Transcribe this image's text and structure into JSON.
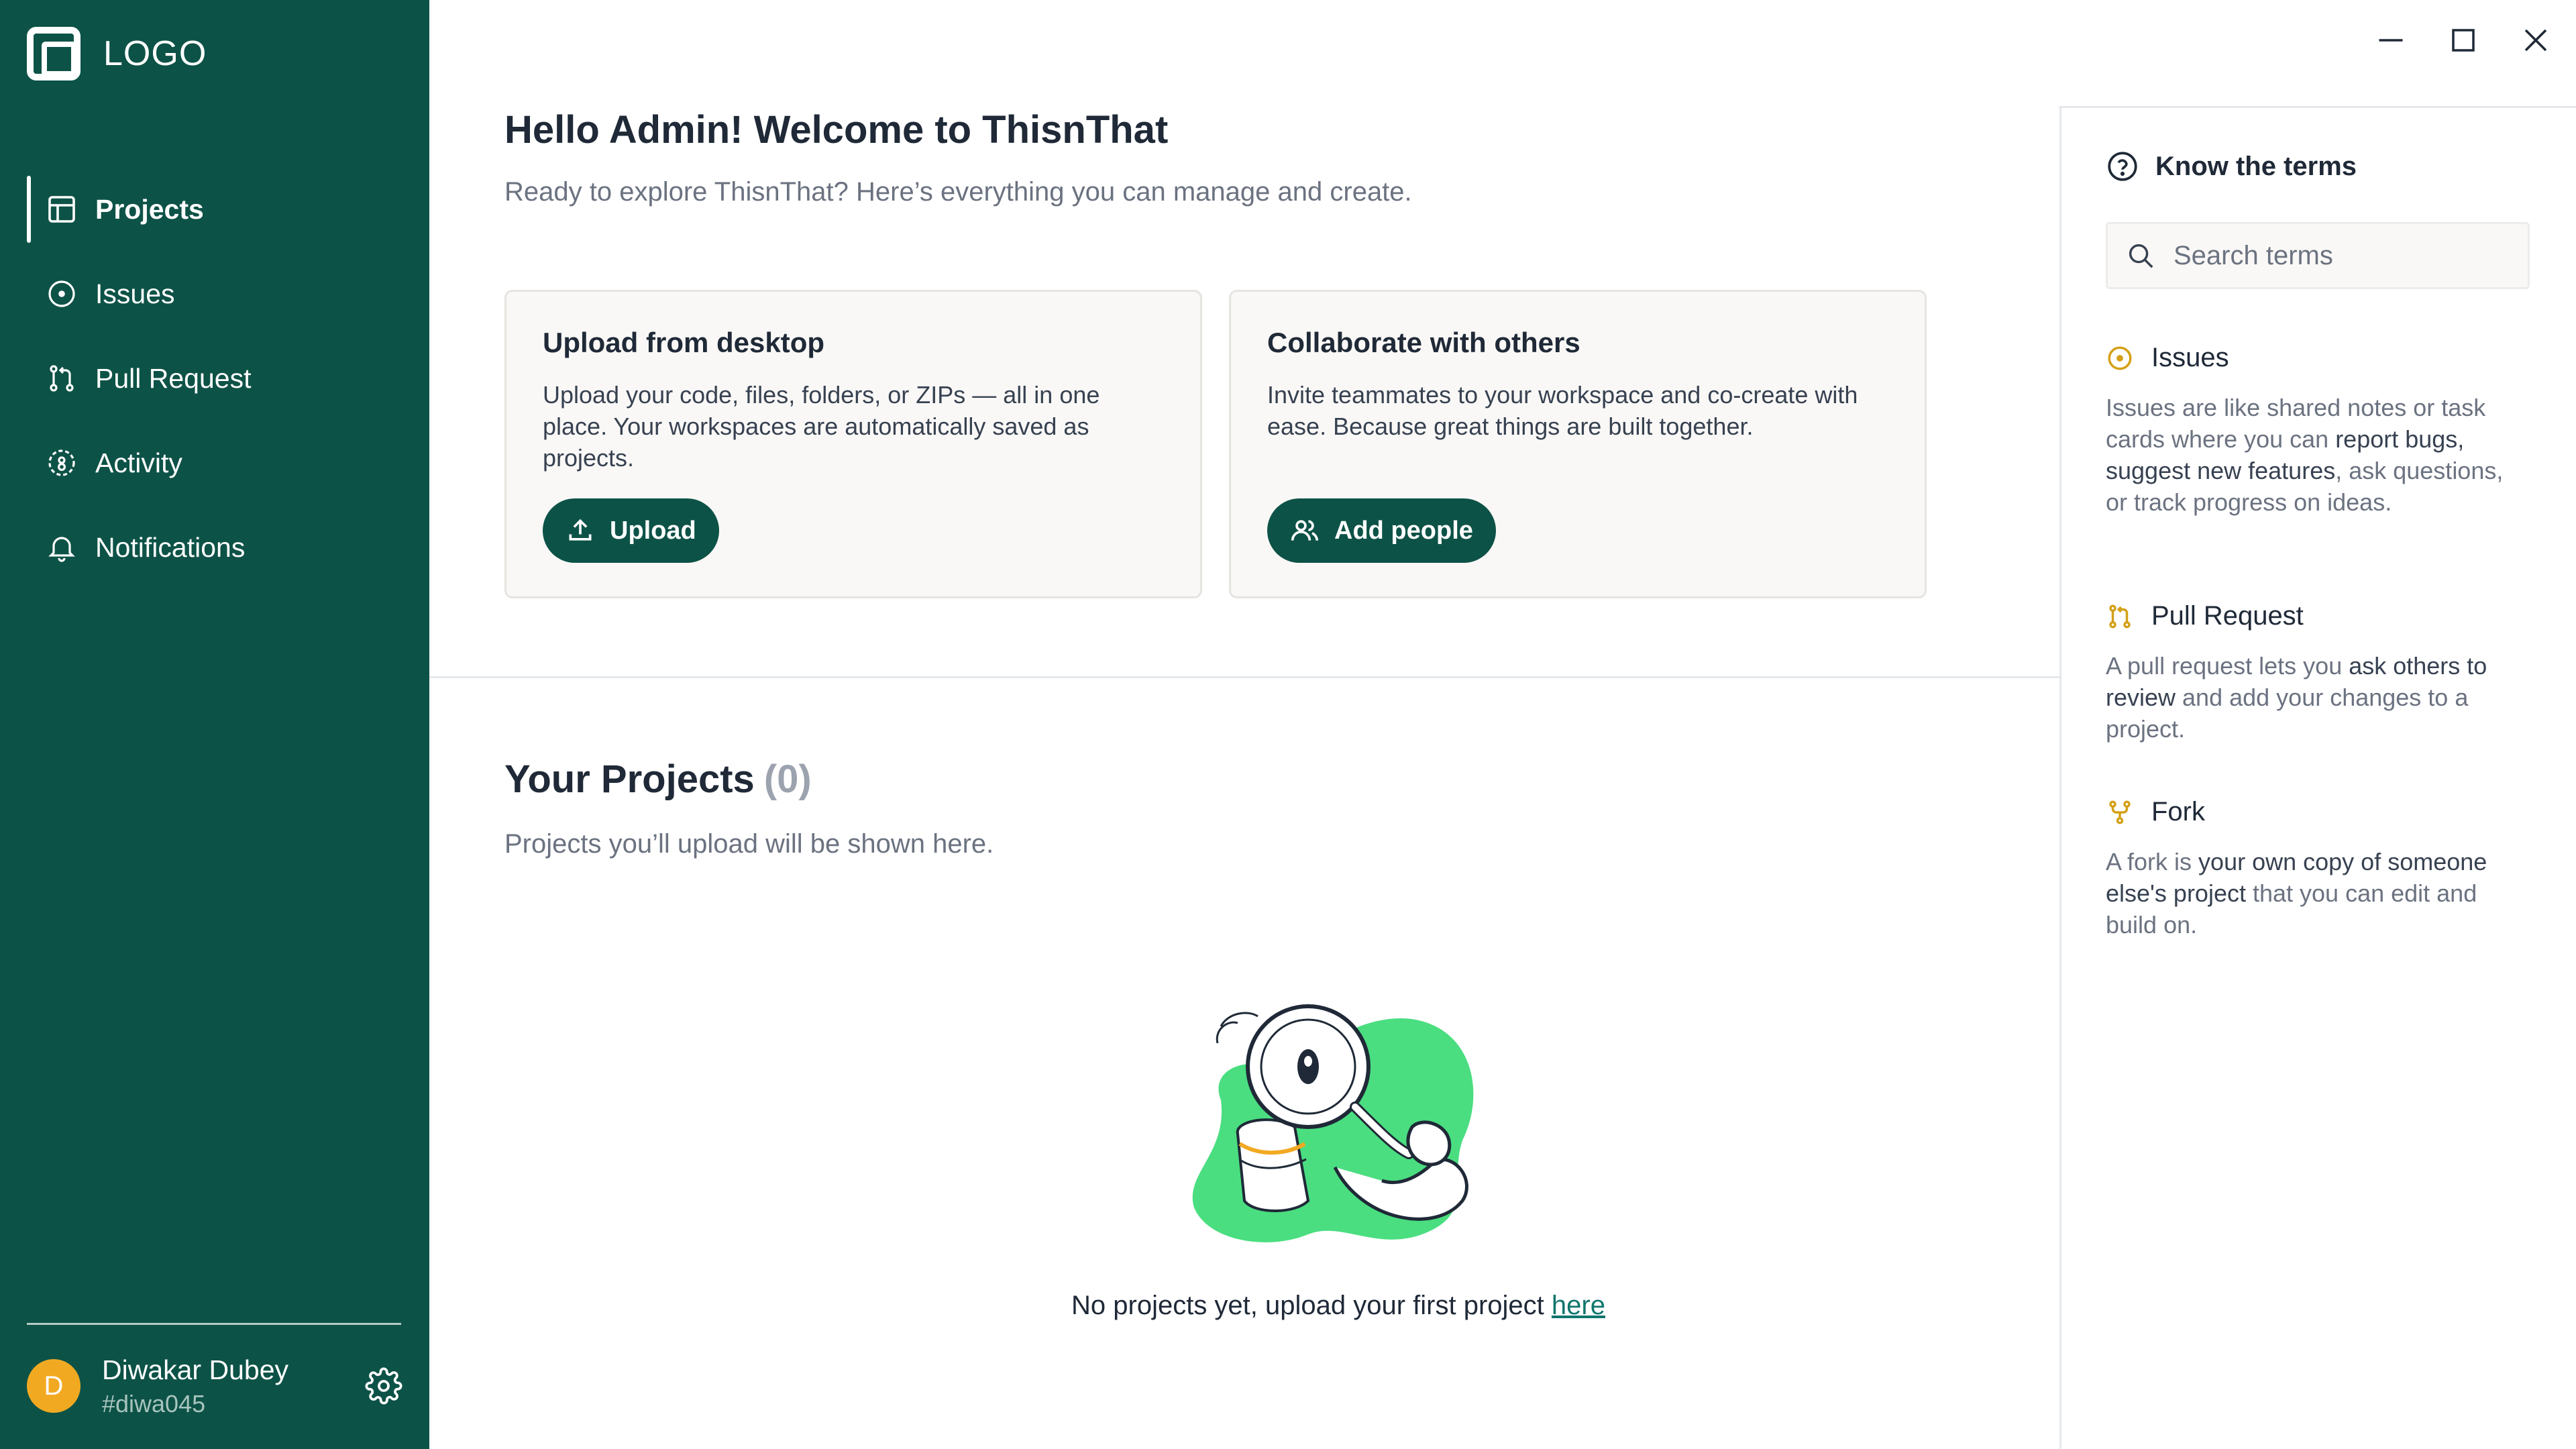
{
  "sidebar": {
    "logo_text": "LOGO",
    "items": [
      {
        "label": "Projects",
        "icon": "grid-icon",
        "active": true
      },
      {
        "label": "Issues",
        "icon": "circle-dot-icon"
      },
      {
        "label": "Pull Request",
        "icon": "git-pull-request-icon"
      },
      {
        "label": "Activity",
        "icon": "activity-icon"
      },
      {
        "label": "Notifications",
        "icon": "bell-icon"
      }
    ],
    "user": {
      "initial": "D",
      "name": "Diwakar Dubey",
      "handle": "#diwa045"
    }
  },
  "main": {
    "title": "Hello Admin! Welcome to ThisnThat",
    "subtitle": "Ready to explore ThisnThat? Here’s everything you can manage and create.",
    "cards": [
      {
        "title": "Upload from desktop",
        "text": "Upload your code, files, folders, or ZIPs — all in one place. Your workspaces are automatically saved as projects.",
        "button": "Upload"
      },
      {
        "title": "Collaborate with others",
        "text": "Invite teammates to your workspace and co-create with ease. Because great things are built together.",
        "button": "Add people"
      }
    ],
    "projects": {
      "title": "Your Projects",
      "count": "(0)",
      "subtitle": "Projects you’ll upload will be shown here.",
      "empty_text": "No projects yet, upload your first project",
      "empty_link": "here"
    }
  },
  "terms": {
    "title": "Know the terms",
    "search_placeholder": "Search terms",
    "items": [
      {
        "title": "Issues",
        "body_parts": [
          "Issues are like shared notes or task cards where you can ",
          "report bugs, suggest new features",
          ", ask questions, or track progress on ideas."
        ]
      },
      {
        "title": "Pull Request",
        "body_parts": [
          "A pull request lets you ",
          "ask others to review",
          " and add your changes to a project."
        ]
      },
      {
        "title": "Fork",
        "body_parts": [
          "A fork is ",
          "your own copy of someone else's project",
          " that you can edit and build on."
        ]
      }
    ]
  },
  "colors": {
    "sidebar_bg": "#0d5247",
    "accent": "#0d5247",
    "term_icon": "#d4a017",
    "illustration_green": "#4ade80"
  }
}
